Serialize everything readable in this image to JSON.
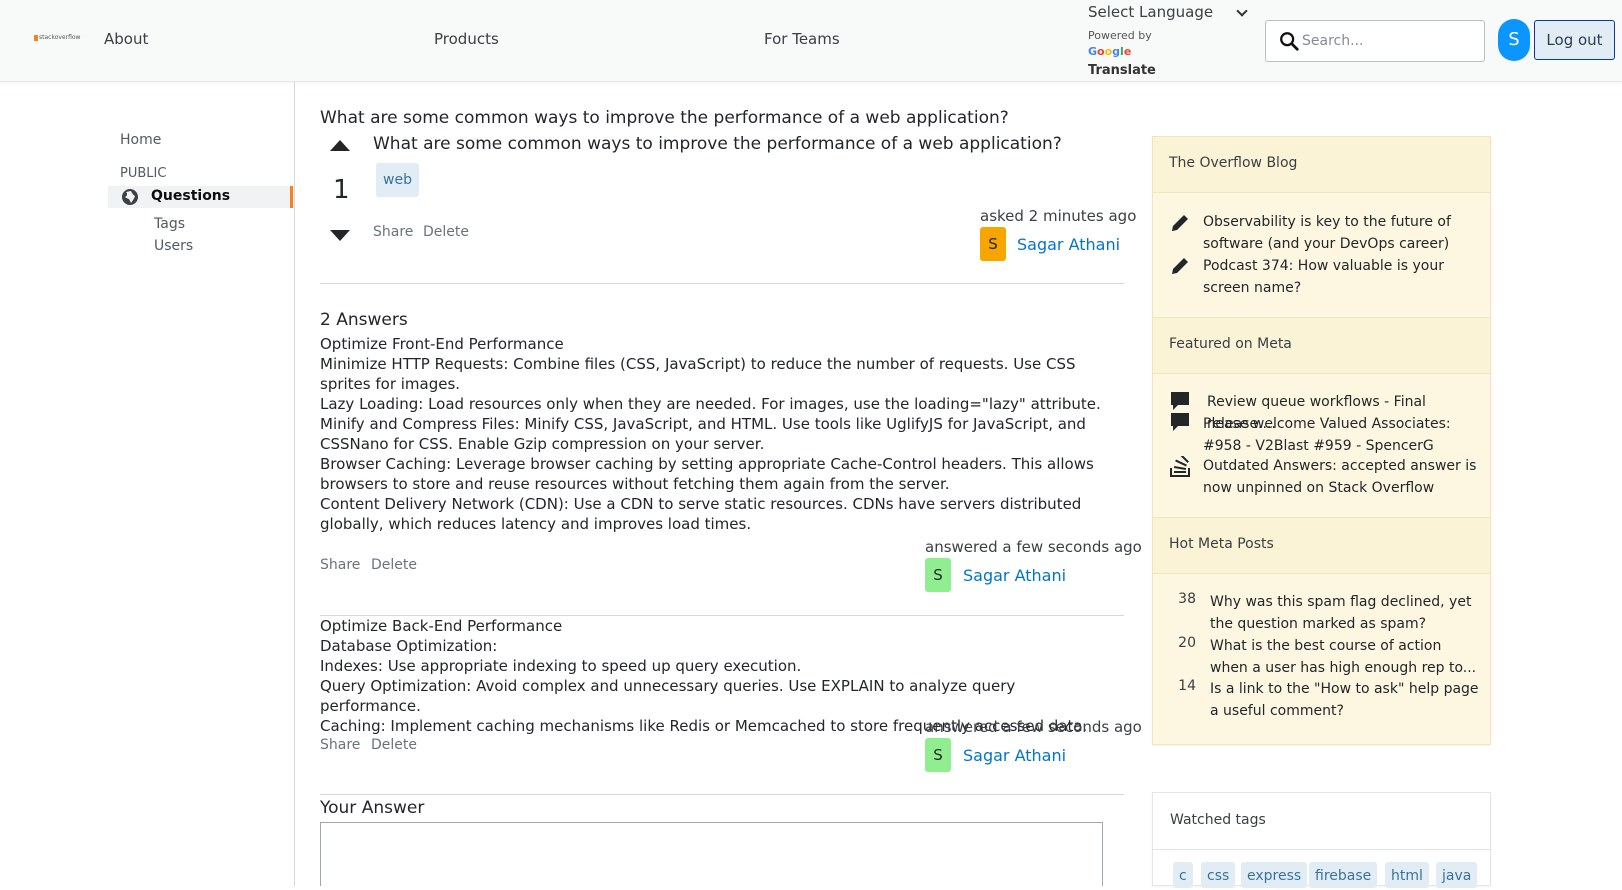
{
  "header": {
    "logo_text": "stackoverflow",
    "nav": [
      "About",
      "Products",
      "For Teams"
    ],
    "language": {
      "selected": "Select Language",
      "powered_by": "Powered by",
      "google": "Google",
      "translate": "Translate"
    },
    "search": {
      "placeholder": "Search..."
    },
    "avatar_initial": "S",
    "logout_label": "Log out"
  },
  "sidebar": {
    "home": "Home",
    "section": "PUBLIC",
    "questions": "Questions",
    "tags": "Tags",
    "users": "Users",
    "active_color": "#f48225"
  },
  "question": {
    "page_title": "What are some common ways to improve the performance of a web application?",
    "body": "What are some common ways to improve the performance of a web application?",
    "score": "1",
    "tags": [
      "web"
    ],
    "share": "Share",
    "delete": "Delete",
    "asked": "asked 2 minutes ago",
    "user_initial": "S",
    "user_name": "Sagar Athani",
    "avatar_color": "#f7a600"
  },
  "answers": {
    "count_label": "2 Answers",
    "items": [
      {
        "lines": [
          "Optimize Front-End Performance",
          "Minimize HTTP Requests: Combine files (CSS, JavaScript) to reduce the number of requests. Use CSS sprites for images.",
          "Lazy Loading: Load resources only when they are needed. For images, use the loading=\"lazy\" attribute.",
          "Minify and Compress Files: Minify CSS, JavaScript, and HTML. Use tools like UglifyJS for JavaScript, and CSSNano for CSS. Enable Gzip compression on your server.",
          "Browser Caching: Leverage browser caching by setting appropriate Cache-Control headers. This allows browsers to store and reuse resources without fetching them again from the server.",
          "Content Delivery Network (CDN): Use a CDN to serve static resources. CDNs have servers distributed globally, which reduces latency and improves load times."
        ],
        "share": "Share",
        "delete": "Delete",
        "answered": "answered a few seconds ago",
        "user_initial": "S",
        "user_name": "Sagar Athani",
        "avatar_color": "#90ee90"
      },
      {
        "lines": [
          "Optimize Back-End Performance",
          "Database Optimization:",
          "Indexes: Use appropriate indexing to speed up query execution.",
          "Query Optimization: Avoid complex and unnecessary queries. Use EXPLAIN to analyze query performance.",
          "Caching: Implement caching mechanisms like Redis or Memcached to store frequently accessed data."
        ],
        "share": "Share",
        "delete": "Delete",
        "answered": "answered a few seconds ago",
        "user_initial": "S",
        "user_name": "Sagar Athani",
        "avatar_color": "#90ee90"
      }
    ],
    "your_answer_label": "Your Answer"
  },
  "widget": {
    "blog_title": "The Overflow Blog",
    "blog_items": [
      {
        "icon": "pencil-icon",
        "text": "Observability is key to the future of software (and your DevOps career)"
      },
      {
        "icon": "pencil-icon",
        "text": "Podcast 374: How valuable is your screen name?"
      }
    ],
    "meta_title": "Featured on Meta",
    "meta_items": [
      {
        "icon": "chat-bubble-icon",
        "text": "Review queue workflows - Final release...."
      },
      {
        "icon": "chat-bubble-icon",
        "text": "Please welcome Valued Associates: #958 - V2Blast #959 - SpencerG"
      },
      {
        "icon": "stack-icon",
        "text": "Outdated Answers: accepted answer is now unpinned on Stack Overflow"
      }
    ],
    "hot_title": "Hot Meta Posts",
    "hot_items": [
      {
        "num": "38",
        "text": "Why was this spam flag declined, yet the question marked as spam?"
      },
      {
        "num": "20",
        "text": "What is the best course of action when a user has high enough rep to..."
      },
      {
        "num": "14",
        "text": "Is a link to the \"How to ask\" help page a useful comment?"
      }
    ],
    "background": "#fdf7e2"
  },
  "watched": {
    "title": "Watched tags",
    "tags": [
      "c",
      "css",
      "express",
      "firebase",
      "html",
      "java"
    ]
  }
}
